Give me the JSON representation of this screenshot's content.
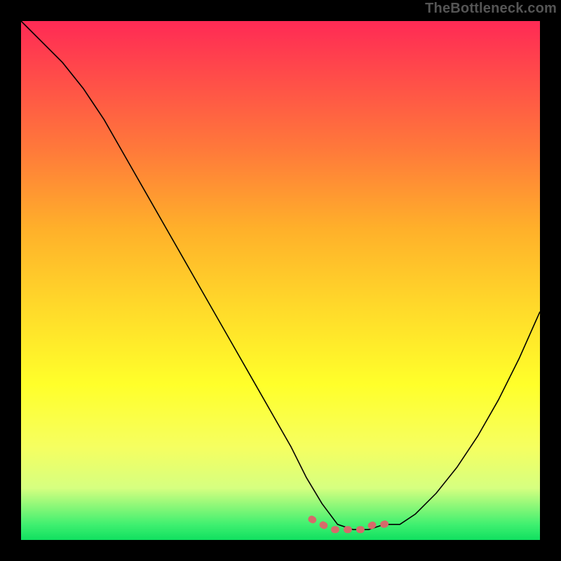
{
  "watermark": "TheBottleneck.com",
  "chart_data": {
    "type": "line",
    "title": "",
    "xlabel": "",
    "ylabel": "",
    "xlim": [
      0,
      100
    ],
    "ylim": [
      0,
      100
    ],
    "series": [
      {
        "name": "bottleneck-curve",
        "x": [
          0,
          4,
          8,
          12,
          16,
          20,
          24,
          28,
          32,
          36,
          40,
          44,
          48,
          52,
          55,
          58,
          61,
          64,
          67,
          70,
          73,
          76,
          80,
          84,
          88,
          92,
          96,
          100
        ],
        "values": [
          100,
          96,
          92,
          87,
          81,
          74,
          67,
          60,
          53,
          46,
          39,
          32,
          25,
          18,
          12,
          7,
          3,
          2,
          2,
          3,
          3,
          5,
          9,
          14,
          20,
          27,
          35,
          44
        ]
      },
      {
        "name": "sweet-spot-marker",
        "x": [
          56,
          58,
          60,
          62,
          64,
          66,
          68,
          70,
          72
        ],
        "values": [
          4,
          3,
          2,
          2,
          2,
          2,
          3,
          3,
          4
        ]
      }
    ],
    "colors": {
      "curve": "#000000",
      "marker": "#d66a6a"
    }
  }
}
